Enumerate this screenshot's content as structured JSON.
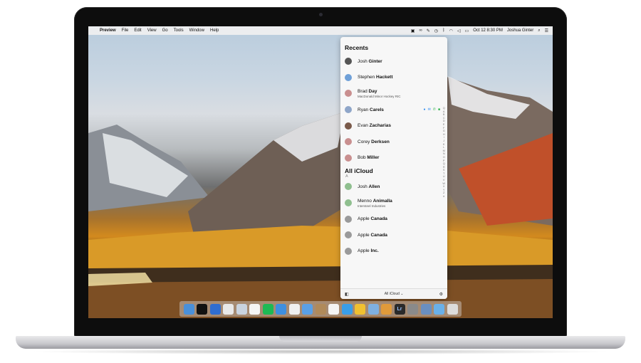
{
  "menubar": {
    "app_name": "Preview",
    "items": [
      "File",
      "Edit",
      "View",
      "Go",
      "Tools",
      "Window",
      "Help"
    ],
    "clock": "Oct 12  8:30 PM",
    "user": "Joshua Ginter"
  },
  "panel": {
    "recents_title": "Recents",
    "recents": [
      {
        "first": "Josh",
        "last": "Ginter",
        "sub": "",
        "avatar": "#555"
      },
      {
        "first": "Stephen",
        "last": "Hackett",
        "sub": "",
        "avatar": "#6fa0d8"
      },
      {
        "first": "Brad",
        "last": "Day",
        "sub": "MacDonald Minor Hockey RIC",
        "avatar": "#c98f8f"
      },
      {
        "first": "Ryan",
        "last": "Carels",
        "sub": "",
        "avatar": "#8fa6c9"
      },
      {
        "first": "Evan",
        "last": "Zacharias",
        "sub": "",
        "avatar": "#7a5a4a"
      },
      {
        "first": "Corey",
        "last": "Derksen",
        "sub": "",
        "avatar": "#c98f8f"
      },
      {
        "first": "Bob",
        "last": "Miller",
        "sub": "",
        "avatar": "#c98f8f"
      }
    ],
    "all_title": "All iCloud",
    "letter_a": "A",
    "all": [
      {
        "first": "Josh",
        "last": "Allen",
        "sub": "",
        "avatar": "#8fbf8f"
      },
      {
        "first": "Menno",
        "last": "Animalla",
        "sub": "Intersteel Industries",
        "avatar": "#8fbf8f"
      },
      {
        "first": "Apple",
        "last": "Canada",
        "sub": "",
        "avatar": "#9a9a9a"
      },
      {
        "first": "Apple",
        "last": "Canada",
        "sub": "",
        "avatar": "#9a9a9a"
      },
      {
        "first": "Apple",
        "last": "Inc.",
        "sub": "",
        "avatar": "#9a9a9a"
      }
    ],
    "alphabet": [
      "Q",
      "A",
      "B",
      "C",
      "D",
      "E",
      "F",
      "G",
      "H",
      "I",
      "J",
      "K",
      "L",
      "M",
      "N",
      "O",
      "P",
      "Q",
      "R",
      "S",
      "T",
      "U",
      "V",
      "W",
      "X",
      "Y",
      "Z",
      "#"
    ],
    "footer_label": "All iCloud ⌄"
  },
  "dock": {
    "icons": [
      {
        "name": "finder-icon",
        "color": "#4a90d9"
      },
      {
        "name": "terminal-icon",
        "color": "#111111"
      },
      {
        "name": "1password-icon",
        "color": "#2f6dd0"
      },
      {
        "name": "tweetbot-icon",
        "color": "#e8e8e8"
      },
      {
        "name": "mail-icon",
        "color": "#c9d3df"
      },
      {
        "name": "calendar-icon",
        "color": "#f5f5f5"
      },
      {
        "name": "spotify-icon",
        "color": "#1db954"
      },
      {
        "name": "safari-icon",
        "color": "#3e8fe0"
      },
      {
        "name": "photos-icon",
        "color": "#f0f0f0"
      },
      {
        "name": "tweetbot-bird-icon",
        "color": "#5aa0e6"
      },
      {
        "name": "contacts-icon",
        "color": "#b08a5a"
      },
      {
        "name": "slack-icon",
        "color": "#f4f4f4"
      },
      {
        "name": "day-one-icon",
        "color": "#3a9ee8"
      },
      {
        "name": "tes-icon",
        "color": "#f0c030"
      },
      {
        "name": "preview-icon",
        "color": "#7fb0e0"
      },
      {
        "name": "books-icon",
        "color": "#e09a3a"
      },
      {
        "name": "lightroom-icon",
        "color": "#2a2a2a"
      },
      {
        "name": "system-preferences-icon",
        "color": "#8a8a8a"
      },
      {
        "name": "app-store-icon",
        "color": "#6a8fc0"
      },
      {
        "name": "folder-icon",
        "color": "#6ab0e8"
      },
      {
        "name": "trash-icon",
        "color": "#dcdcdc"
      }
    ],
    "lightroom_label": "Lr"
  }
}
